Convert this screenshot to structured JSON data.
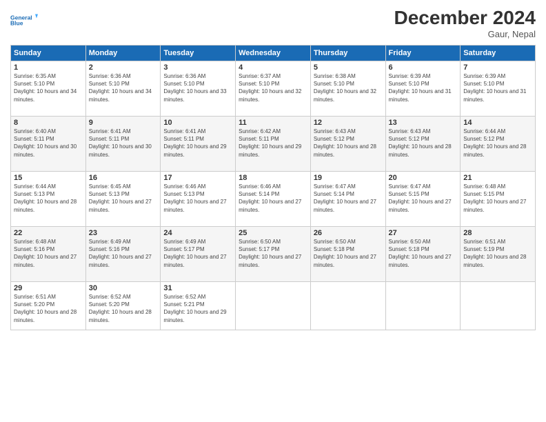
{
  "header": {
    "logo_line1": "General",
    "logo_line2": "Blue",
    "month_title": "December 2024",
    "subtitle": "Gaur, Nepal"
  },
  "days_of_week": [
    "Sunday",
    "Monday",
    "Tuesday",
    "Wednesday",
    "Thursday",
    "Friday",
    "Saturday"
  ],
  "weeks": [
    [
      {
        "day": 1,
        "sunrise": "6:35 AM",
        "sunset": "5:10 PM",
        "daylight": "10 hours and 34 minutes."
      },
      {
        "day": 2,
        "sunrise": "6:36 AM",
        "sunset": "5:10 PM",
        "daylight": "10 hours and 34 minutes."
      },
      {
        "day": 3,
        "sunrise": "6:36 AM",
        "sunset": "5:10 PM",
        "daylight": "10 hours and 33 minutes."
      },
      {
        "day": 4,
        "sunrise": "6:37 AM",
        "sunset": "5:10 PM",
        "daylight": "10 hours and 32 minutes."
      },
      {
        "day": 5,
        "sunrise": "6:38 AM",
        "sunset": "5:10 PM",
        "daylight": "10 hours and 32 minutes."
      },
      {
        "day": 6,
        "sunrise": "6:39 AM",
        "sunset": "5:10 PM",
        "daylight": "10 hours and 31 minutes."
      },
      {
        "day": 7,
        "sunrise": "6:39 AM",
        "sunset": "5:10 PM",
        "daylight": "10 hours and 31 minutes."
      }
    ],
    [
      {
        "day": 8,
        "sunrise": "6:40 AM",
        "sunset": "5:11 PM",
        "daylight": "10 hours and 30 minutes."
      },
      {
        "day": 9,
        "sunrise": "6:41 AM",
        "sunset": "5:11 PM",
        "daylight": "10 hours and 30 minutes."
      },
      {
        "day": 10,
        "sunrise": "6:41 AM",
        "sunset": "5:11 PM",
        "daylight": "10 hours and 29 minutes."
      },
      {
        "day": 11,
        "sunrise": "6:42 AM",
        "sunset": "5:11 PM",
        "daylight": "10 hours and 29 minutes."
      },
      {
        "day": 12,
        "sunrise": "6:43 AM",
        "sunset": "5:12 PM",
        "daylight": "10 hours and 28 minutes."
      },
      {
        "day": 13,
        "sunrise": "6:43 AM",
        "sunset": "5:12 PM",
        "daylight": "10 hours and 28 minutes."
      },
      {
        "day": 14,
        "sunrise": "6:44 AM",
        "sunset": "5:12 PM",
        "daylight": "10 hours and 28 minutes."
      }
    ],
    [
      {
        "day": 15,
        "sunrise": "6:44 AM",
        "sunset": "5:13 PM",
        "daylight": "10 hours and 28 minutes."
      },
      {
        "day": 16,
        "sunrise": "6:45 AM",
        "sunset": "5:13 PM",
        "daylight": "10 hours and 27 minutes."
      },
      {
        "day": 17,
        "sunrise": "6:46 AM",
        "sunset": "5:13 PM",
        "daylight": "10 hours and 27 minutes."
      },
      {
        "day": 18,
        "sunrise": "6:46 AM",
        "sunset": "5:14 PM",
        "daylight": "10 hours and 27 minutes."
      },
      {
        "day": 19,
        "sunrise": "6:47 AM",
        "sunset": "5:14 PM",
        "daylight": "10 hours and 27 minutes."
      },
      {
        "day": 20,
        "sunrise": "6:47 AM",
        "sunset": "5:15 PM",
        "daylight": "10 hours and 27 minutes."
      },
      {
        "day": 21,
        "sunrise": "6:48 AM",
        "sunset": "5:15 PM",
        "daylight": "10 hours and 27 minutes."
      }
    ],
    [
      {
        "day": 22,
        "sunrise": "6:48 AM",
        "sunset": "5:16 PM",
        "daylight": "10 hours and 27 minutes."
      },
      {
        "day": 23,
        "sunrise": "6:49 AM",
        "sunset": "5:16 PM",
        "daylight": "10 hours and 27 minutes."
      },
      {
        "day": 24,
        "sunrise": "6:49 AM",
        "sunset": "5:17 PM",
        "daylight": "10 hours and 27 minutes."
      },
      {
        "day": 25,
        "sunrise": "6:50 AM",
        "sunset": "5:17 PM",
        "daylight": "10 hours and 27 minutes."
      },
      {
        "day": 26,
        "sunrise": "6:50 AM",
        "sunset": "5:18 PM",
        "daylight": "10 hours and 27 minutes."
      },
      {
        "day": 27,
        "sunrise": "6:50 AM",
        "sunset": "5:18 PM",
        "daylight": "10 hours and 27 minutes."
      },
      {
        "day": 28,
        "sunrise": "6:51 AM",
        "sunset": "5:19 PM",
        "daylight": "10 hours and 28 minutes."
      }
    ],
    [
      {
        "day": 29,
        "sunrise": "6:51 AM",
        "sunset": "5:20 PM",
        "daylight": "10 hours and 28 minutes."
      },
      {
        "day": 30,
        "sunrise": "6:52 AM",
        "sunset": "5:20 PM",
        "daylight": "10 hours and 28 minutes."
      },
      {
        "day": 31,
        "sunrise": "6:52 AM",
        "sunset": "5:21 PM",
        "daylight": "10 hours and 29 minutes."
      },
      null,
      null,
      null,
      null
    ]
  ]
}
